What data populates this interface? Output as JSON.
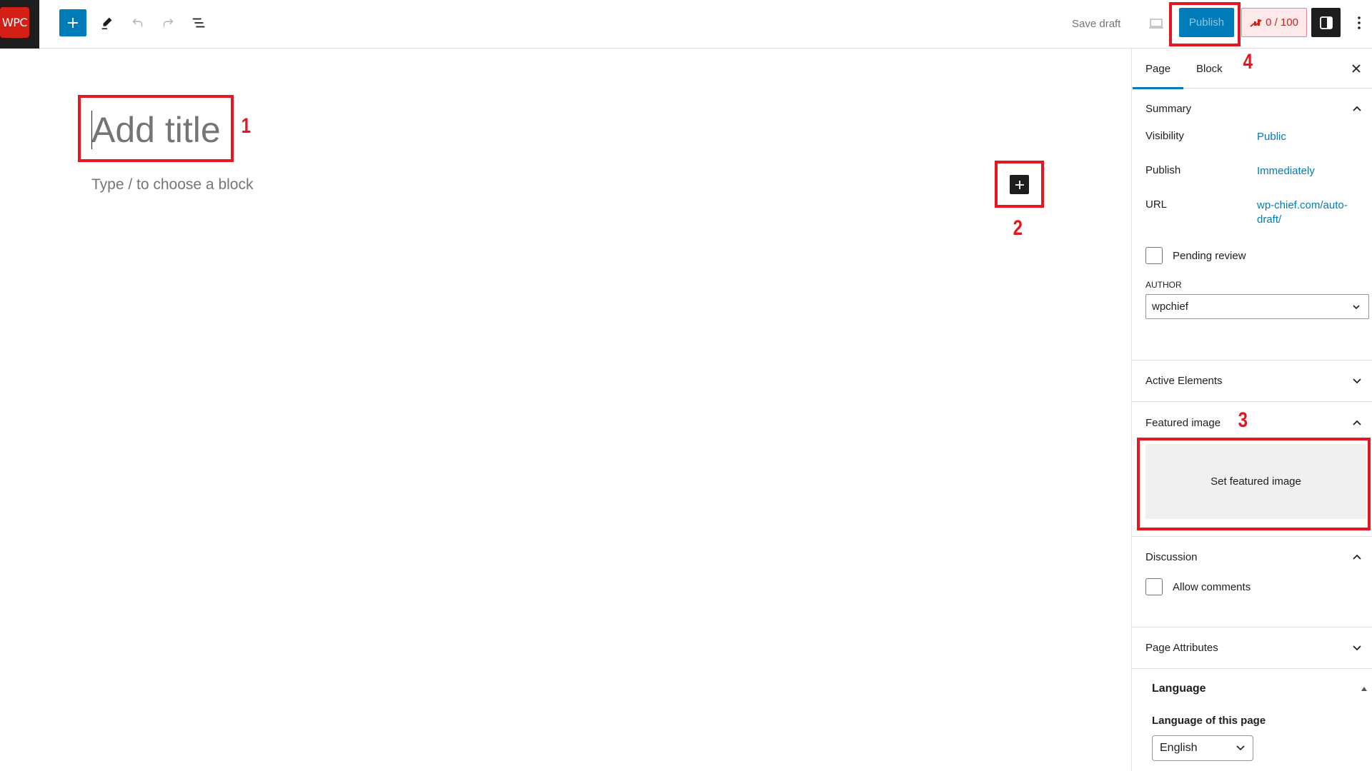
{
  "header": {
    "logo_text": "WPC",
    "inserter_icon": "plus-icon",
    "tools_icon": "pencil-icon",
    "undo_icon": "undo-icon",
    "redo_icon": "redo-icon",
    "list_view_icon": "list-view-icon",
    "save_draft_label": "Save draft",
    "preview_icon": "desktop-preview-icon",
    "publish_label": "Publish",
    "seo_score": "0 / 100",
    "seo_icon": "score-chart-icon",
    "settings_icon": "sidebar-toggle-icon",
    "more_icon": "kebab-menu-icon"
  },
  "editor": {
    "title_placeholder": "Add title",
    "block_placeholder": "Type / to choose a block",
    "block_inserter_icon": "plus-icon"
  },
  "sidebar": {
    "tabs": [
      {
        "label": "Page",
        "active": true
      },
      {
        "label": "Block",
        "active": false
      }
    ],
    "close_icon": "close-icon",
    "summary": {
      "title": "Summary",
      "expanded": true,
      "rows": [
        {
          "label": "Visibility",
          "value": "Public"
        },
        {
          "label": "Publish",
          "value": "Immediately"
        },
        {
          "label": "URL",
          "value": "wp-chief.com/auto-draft/"
        }
      ],
      "url_line1": "wp-chief.com/auto-",
      "url_line2": "draft/",
      "pending_review_label": "Pending review",
      "pending_review_checked": false,
      "author_label": "AUTHOR",
      "author_value": "wpchief"
    },
    "active_elements": {
      "title": "Active Elements",
      "expanded": false
    },
    "featured_image": {
      "title": "Featured image",
      "expanded": true,
      "button_label": "Set featured image"
    },
    "discussion": {
      "title": "Discussion",
      "expanded": true,
      "allow_comments_label": "Allow comments",
      "allow_comments_checked": false
    },
    "page_attributes": {
      "title": "Page Attributes",
      "expanded": false
    },
    "language": {
      "title": "Language",
      "subtitle": "Language of this page",
      "value": "English"
    }
  },
  "annotations": [
    {
      "number": "1",
      "target": "title"
    },
    {
      "number": "2",
      "target": "block-inserter"
    },
    {
      "number": "3",
      "target": "featured-image"
    },
    {
      "number": "4",
      "target": "publish"
    }
  ],
  "colors": {
    "accent": "#007cba",
    "annotation": "#e4161f",
    "logo": "#d41f16",
    "dark": "#1e1e1e"
  }
}
